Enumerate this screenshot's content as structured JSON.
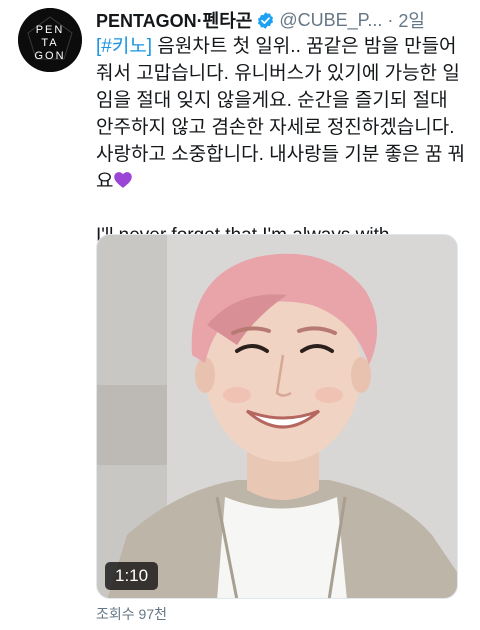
{
  "tweet": {
    "display_name": "PENTAGON·펜타곤",
    "handle": "@CUBE_P...",
    "separator": "·",
    "time": "2일",
    "avatar_logo": [
      "PEN",
      "TA",
      "GON"
    ],
    "body": {
      "hashtag": "[#키노]",
      "korean_text": " 음원차트 첫 일위.. 꿈같은 밤을 만들어줘서 고맙습니다. 유니버스가 있기에 가능한 일임을 절대 잊지 않을게요. 순간을 즐기되 절대 안주하지 않고 겸손한 자세로 정진하겠습니다. 사랑하고 소중합니다. 내사랑들 기분 좋은 꿈 꿔요",
      "english_text": "I'll never forget that I'm always with UNIVERSE"
    },
    "media": {
      "duration": "1:10"
    },
    "views": "조회수 97천"
  },
  "colors": {
    "hashtag": "#1b95e0",
    "verified": "#1da1f2",
    "secondary_text": "#657786"
  },
  "icons": {
    "verified": "verified-badge-icon",
    "purple_heart": "purple-heart-emoji",
    "white_heart": "white-heart-emoji",
    "more": "more-icon"
  }
}
